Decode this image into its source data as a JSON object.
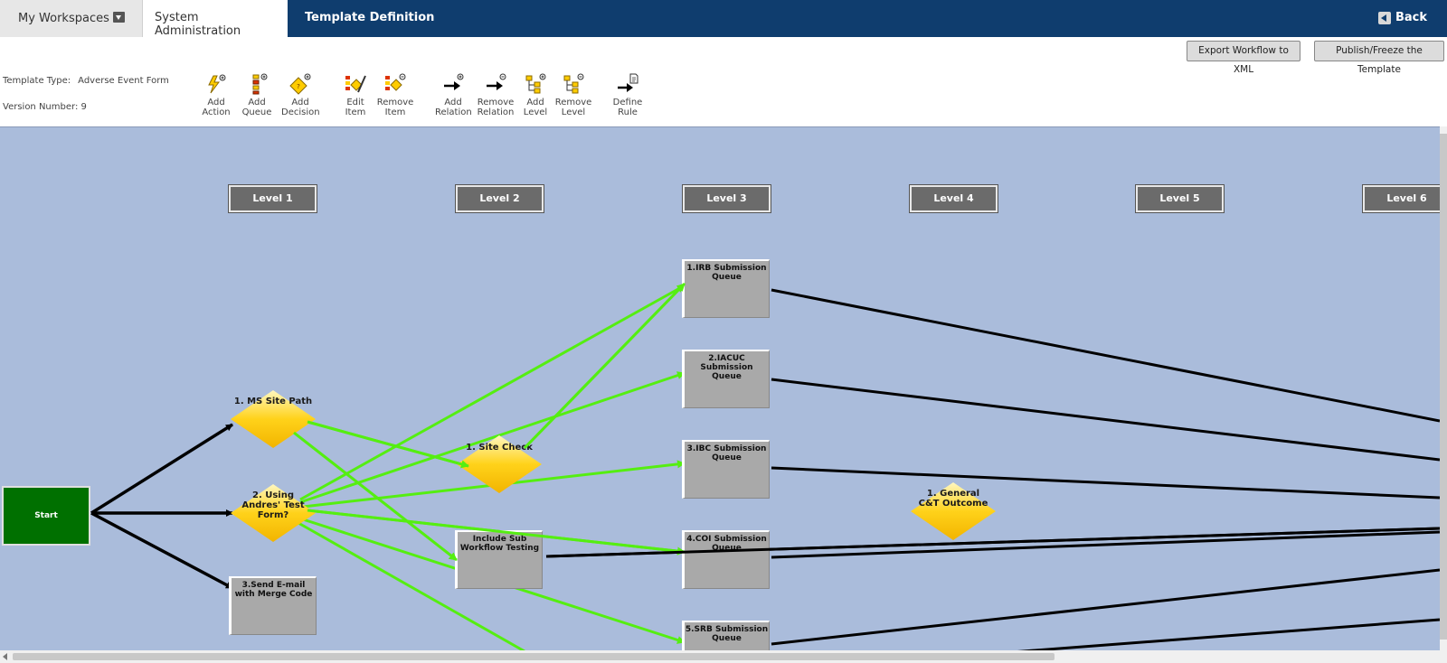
{
  "nav": {
    "tab_workspaces": "My Workspaces",
    "tab_sysadmin": "System Administration",
    "tab_template": "Template Definition",
    "back": "Back"
  },
  "header": {
    "export_label": "Export Workflow to XML",
    "publish_label": "Publish/Freeze the Template",
    "template_type_label": "Template Type:",
    "template_type_value": "Adverse Event Form",
    "version_label": "Version Number:",
    "version_value": "9"
  },
  "toolbar": [
    {
      "l1": "Add",
      "l2": "Action",
      "icon": "add-action-icon"
    },
    {
      "l1": "Add",
      "l2": "Queue",
      "icon": "add-queue-icon"
    },
    {
      "l1": "Add",
      "l2": "Decision",
      "icon": "add-decision-icon"
    },
    {
      "l1": "Edit",
      "l2": "Item",
      "icon": "edit-item-icon"
    },
    {
      "l1": "Remove",
      "l2": "Item",
      "icon": "remove-item-icon"
    },
    {
      "l1": "Add",
      "l2": "Relation",
      "icon": "add-relation-icon"
    },
    {
      "l1": "Remove",
      "l2": "Relation",
      "icon": "remove-relation-icon"
    },
    {
      "l1": "Add",
      "l2": "Level",
      "icon": "add-level-icon"
    },
    {
      "l1": "Remove",
      "l2": "Level",
      "icon": "remove-level-icon"
    },
    {
      "l1": "Define",
      "l2": "Rule",
      "icon": "define-rule-icon"
    }
  ],
  "levels": [
    "Level 1",
    "Level 2",
    "Level 3",
    "Level 4",
    "Level 5",
    "Level 6"
  ],
  "nodes": {
    "start": "Start",
    "ms_site_path": "1. MS Site Path",
    "using_andres_a": "2. Using",
    "using_andres_b": "Andres' Test",
    "using_andres_c": "Form?",
    "send_email_a": "3.Send E-mail",
    "send_email_b": "with Merge Code",
    "site_check": "1. Site Check",
    "include_sub_a": "Include Sub",
    "include_sub_b": "Workflow Testing",
    "irb_a": "1.IRB Submission",
    "irb_b": "Queue",
    "iacuc_a": "2.IACUC",
    "iacuc_b": "Submission",
    "iacuc_c": "Queue",
    "ibc_a": "3.IBC Submission",
    "ibc_b": "Queue",
    "coi_a": "4.COI Submission",
    "coi_b": "Queue",
    "srb_a": "5.SRB Submission",
    "srb_b": "Queue",
    "general_a": "1. General",
    "general_b": "C&T Outcome"
  },
  "colors": {
    "nav_bg": "#0f3d6e",
    "canvas_bg": "#aabcdb",
    "relation_green": "#55ee11",
    "relation_black": "#000000",
    "start_green": "#007000",
    "queue_gray": "#a9a9a9",
    "decision_yellow": "#ffd21a"
  }
}
